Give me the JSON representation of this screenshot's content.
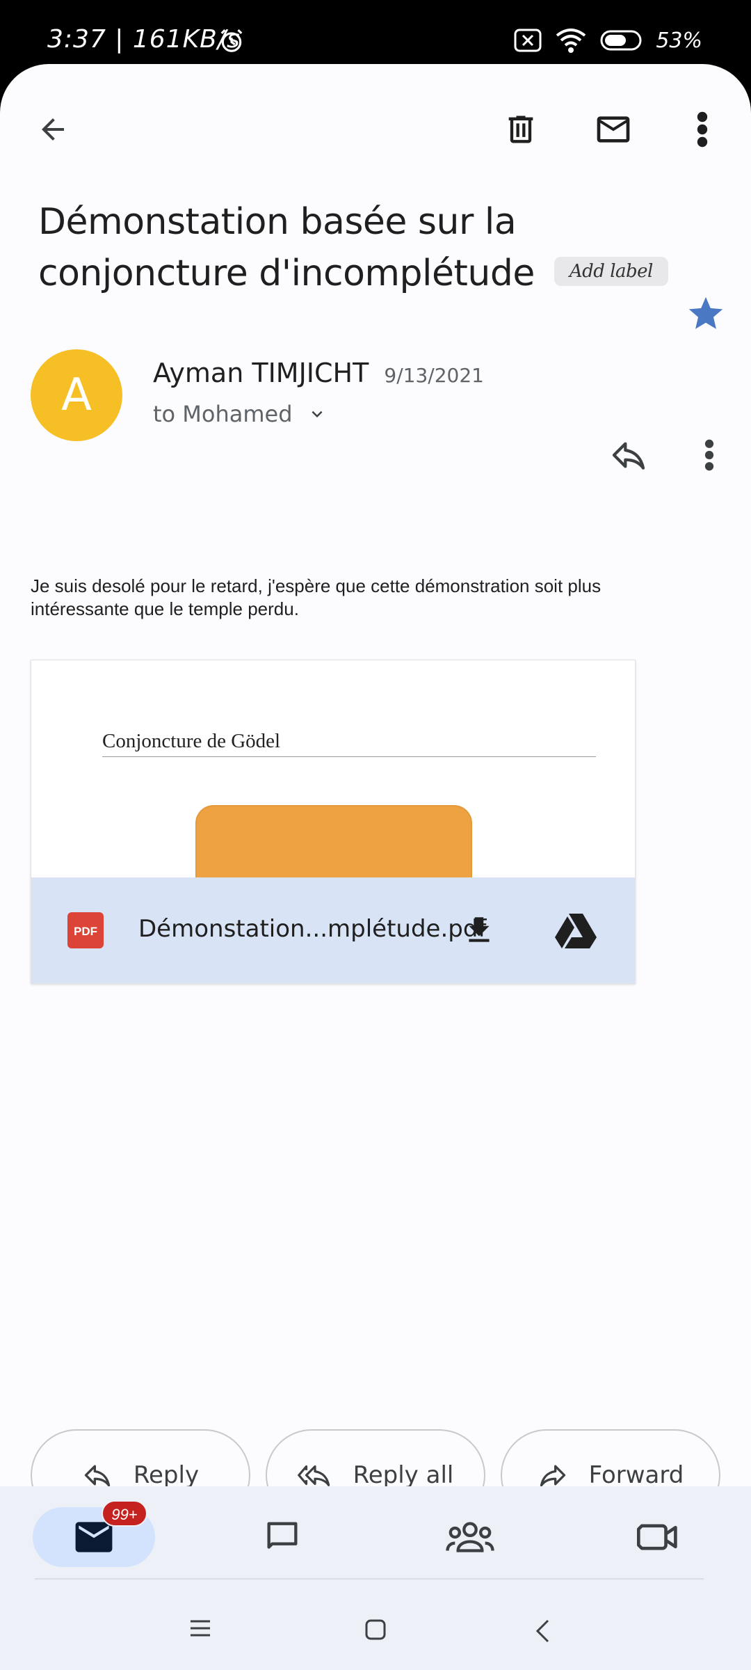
{
  "status_bar": {
    "time": "3:37 | 161KB/s",
    "battery": "53%"
  },
  "email": {
    "subject": "Démonstation basée sur la conjoncture d'incomplétude",
    "label_chip": "Add label",
    "sender": {
      "initial": "A",
      "name": "Ayman TIMJICHT",
      "date": "9/13/2021",
      "to": "to Mohamed",
      "avatar_color": "#f6bf26"
    },
    "body": "Je suis desolé pour le retard, j'espère que cette démonstration soit plus intéressante que le temple perdu.",
    "attachment": {
      "preview_title": "Conjoncture de Gödel",
      "filename": "Démonstation...mplétude.pdf",
      "type_badge": "PDF"
    }
  },
  "actions": {
    "reply": "Reply",
    "reply_all": "Reply all",
    "forward": "Forward"
  },
  "bottom_nav": {
    "mail_badge": "99+",
    "items": [
      "mail-icon",
      "chat-icon",
      "spaces-icon",
      "meet-icon"
    ]
  },
  "colors": {
    "accent_star": "#4a78c2",
    "pdf_red": "#db4437",
    "badge_red": "#c5221f"
  }
}
